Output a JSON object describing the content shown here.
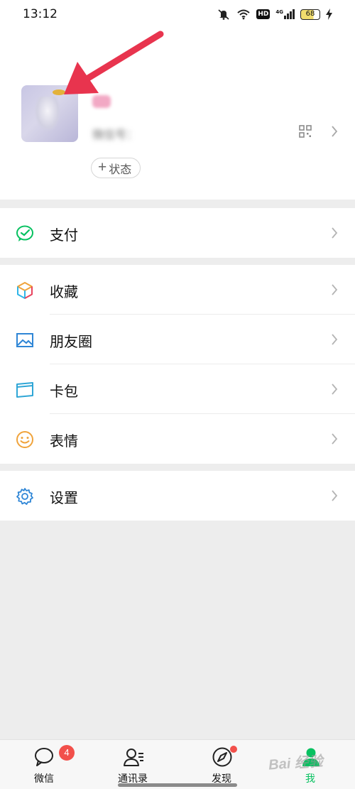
{
  "status_bar": {
    "time": "13:12",
    "hd": "HD",
    "signal": "4G",
    "battery": "68"
  },
  "profile": {
    "wxid_label": "微信号：",
    "status_button": {
      "plus": "+",
      "label": "状态"
    }
  },
  "menu": {
    "pay": {
      "label": "支付",
      "icon": "wechat-pay-icon"
    },
    "favorites": {
      "label": "收藏",
      "icon": "cube-icon"
    },
    "moments": {
      "label": "朋友圈",
      "icon": "image-icon"
    },
    "cards": {
      "label": "卡包",
      "icon": "card-icon"
    },
    "stickers": {
      "label": "表情",
      "icon": "smile-icon"
    },
    "settings": {
      "label": "设置",
      "icon": "gear-icon"
    }
  },
  "tabs": [
    {
      "label": "微信",
      "badge": "4",
      "icon": "chat-icon"
    },
    {
      "label": "通讯录",
      "icon": "contacts-icon"
    },
    {
      "label": "发现",
      "icon": "compass-icon"
    },
    {
      "label": "我",
      "icon": "me-icon",
      "active": true
    }
  ],
  "watermark": "Bai 经验",
  "colors": {
    "accent": "#07c160",
    "badge": "#f2504b",
    "arrow": "#e8344e"
  }
}
